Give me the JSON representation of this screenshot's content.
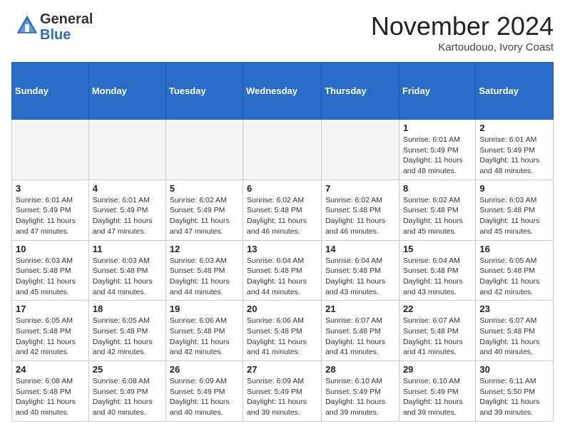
{
  "header": {
    "logo_general": "General",
    "logo_blue": "Blue",
    "month_title": "November 2024",
    "location": "Kartoudouo, Ivory Coast"
  },
  "days_of_week": [
    "Sunday",
    "Monday",
    "Tuesday",
    "Wednesday",
    "Thursday",
    "Friday",
    "Saturday"
  ],
  "weeks": [
    [
      {
        "day": null,
        "info": null
      },
      {
        "day": null,
        "info": null
      },
      {
        "day": null,
        "info": null
      },
      {
        "day": null,
        "info": null
      },
      {
        "day": null,
        "info": null
      },
      {
        "day": "1",
        "info": "Sunrise: 6:01 AM\nSunset: 5:49 PM\nDaylight: 11 hours\nand 48 minutes."
      },
      {
        "day": "2",
        "info": "Sunrise: 6:01 AM\nSunset: 5:49 PM\nDaylight: 11 hours\nand 48 minutes."
      }
    ],
    [
      {
        "day": "3",
        "info": "Sunrise: 6:01 AM\nSunset: 5:49 PM\nDaylight: 11 hours\nand 47 minutes."
      },
      {
        "day": "4",
        "info": "Sunrise: 6:01 AM\nSunset: 5:49 PM\nDaylight: 11 hours\nand 47 minutes."
      },
      {
        "day": "5",
        "info": "Sunrise: 6:02 AM\nSunset: 5:49 PM\nDaylight: 11 hours\nand 47 minutes."
      },
      {
        "day": "6",
        "info": "Sunrise: 6:02 AM\nSunset: 5:48 PM\nDaylight: 11 hours\nand 46 minutes."
      },
      {
        "day": "7",
        "info": "Sunrise: 6:02 AM\nSunset: 5:48 PM\nDaylight: 11 hours\nand 46 minutes."
      },
      {
        "day": "8",
        "info": "Sunrise: 6:02 AM\nSunset: 5:48 PM\nDaylight: 11 hours\nand 45 minutes."
      },
      {
        "day": "9",
        "info": "Sunrise: 6:03 AM\nSunset: 5:48 PM\nDaylight: 11 hours\nand 45 minutes."
      }
    ],
    [
      {
        "day": "10",
        "info": "Sunrise: 6:03 AM\nSunset: 5:48 PM\nDaylight: 11 hours\nand 45 minutes."
      },
      {
        "day": "11",
        "info": "Sunrise: 6:03 AM\nSunset: 5:48 PM\nDaylight: 11 hours\nand 44 minutes."
      },
      {
        "day": "12",
        "info": "Sunrise: 6:03 AM\nSunset: 5:48 PM\nDaylight: 11 hours\nand 44 minutes."
      },
      {
        "day": "13",
        "info": "Sunrise: 6:04 AM\nSunset: 5:48 PM\nDaylight: 11 hours\nand 44 minutes."
      },
      {
        "day": "14",
        "info": "Sunrise: 6:04 AM\nSunset: 5:48 PM\nDaylight: 11 hours\nand 43 minutes."
      },
      {
        "day": "15",
        "info": "Sunrise: 6:04 AM\nSunset: 5:48 PM\nDaylight: 11 hours\nand 43 minutes."
      },
      {
        "day": "16",
        "info": "Sunrise: 6:05 AM\nSunset: 5:48 PM\nDaylight: 11 hours\nand 42 minutes."
      }
    ],
    [
      {
        "day": "17",
        "info": "Sunrise: 6:05 AM\nSunset: 5:48 PM\nDaylight: 11 hours\nand 42 minutes."
      },
      {
        "day": "18",
        "info": "Sunrise: 6:05 AM\nSunset: 5:48 PM\nDaylight: 11 hours\nand 42 minutes."
      },
      {
        "day": "19",
        "info": "Sunrise: 6:06 AM\nSunset: 5:48 PM\nDaylight: 11 hours\nand 42 minutes."
      },
      {
        "day": "20",
        "info": "Sunrise: 6:06 AM\nSunset: 5:48 PM\nDaylight: 11 hours\nand 41 minutes."
      },
      {
        "day": "21",
        "info": "Sunrise: 6:07 AM\nSunset: 5:48 PM\nDaylight: 11 hours\nand 41 minutes."
      },
      {
        "day": "22",
        "info": "Sunrise: 6:07 AM\nSunset: 5:48 PM\nDaylight: 11 hours\nand 41 minutes."
      },
      {
        "day": "23",
        "info": "Sunrise: 6:07 AM\nSunset: 5:48 PM\nDaylight: 11 hours\nand 40 minutes."
      }
    ],
    [
      {
        "day": "24",
        "info": "Sunrise: 6:08 AM\nSunset: 5:48 PM\nDaylight: 11 hours\nand 40 minutes."
      },
      {
        "day": "25",
        "info": "Sunrise: 6:08 AM\nSunset: 5:49 PM\nDaylight: 11 hours\nand 40 minutes."
      },
      {
        "day": "26",
        "info": "Sunrise: 6:09 AM\nSunset: 5:49 PM\nDaylight: 11 hours\nand 40 minutes."
      },
      {
        "day": "27",
        "info": "Sunrise: 6:09 AM\nSunset: 5:49 PM\nDaylight: 11 hours\nand 39 minutes."
      },
      {
        "day": "28",
        "info": "Sunrise: 6:10 AM\nSunset: 5:49 PM\nDaylight: 11 hours\nand 39 minutes."
      },
      {
        "day": "29",
        "info": "Sunrise: 6:10 AM\nSunset: 5:49 PM\nDaylight: 11 hours\nand 39 minutes."
      },
      {
        "day": "30",
        "info": "Sunrise: 6:11 AM\nSunset: 5:50 PM\nDaylight: 11 hours\nand 39 minutes."
      }
    ]
  ]
}
